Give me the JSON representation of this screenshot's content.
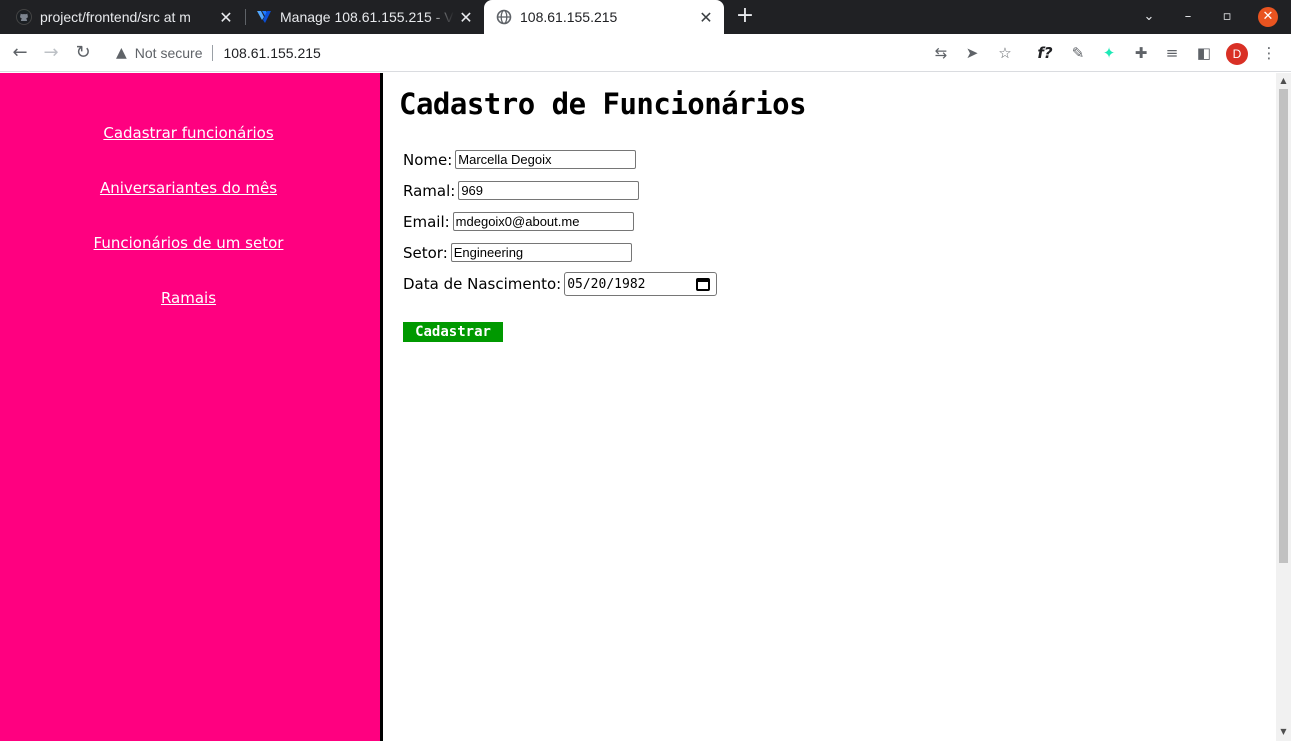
{
  "browser": {
    "tabs": [
      {
        "title": "project/frontend/src at m",
        "favicon": "github-icon",
        "active": false
      },
      {
        "title": "Manage 108.61.155.215 - V",
        "favicon": "vultr-icon",
        "active": false
      },
      {
        "title": "108.61.155.215",
        "favicon": "globe-icon",
        "active": true
      }
    ],
    "new_tab_label": "+",
    "security_label": "Not secure",
    "url": "108.61.155.215",
    "profile_initial": "D",
    "extension_text": "f?"
  },
  "sidebar": {
    "links": [
      {
        "label": "Cadastrar funcionários"
      },
      {
        "label": "Aniversariantes do mês"
      },
      {
        "label": "Funcionários de um setor"
      },
      {
        "label": "Ramais"
      }
    ]
  },
  "page": {
    "title": "Cadastro de Funcionários",
    "form": {
      "nome": {
        "label": "Nome:",
        "value": "Marcella Degoix"
      },
      "ramal": {
        "label": "Ramal:",
        "value": "969"
      },
      "email": {
        "label": "Email:",
        "value": "mdegoix0@about.me"
      },
      "setor": {
        "label": "Setor:",
        "value": "Engineering"
      },
      "nascimento": {
        "label": "Data de Nascimento:",
        "value": "05/20/1982"
      },
      "submit_label": "Cadastrar"
    }
  },
  "colors": {
    "sidebar_bg": "#ff0080",
    "submit_bg": "#009900",
    "tabbar_bg": "#202124"
  }
}
